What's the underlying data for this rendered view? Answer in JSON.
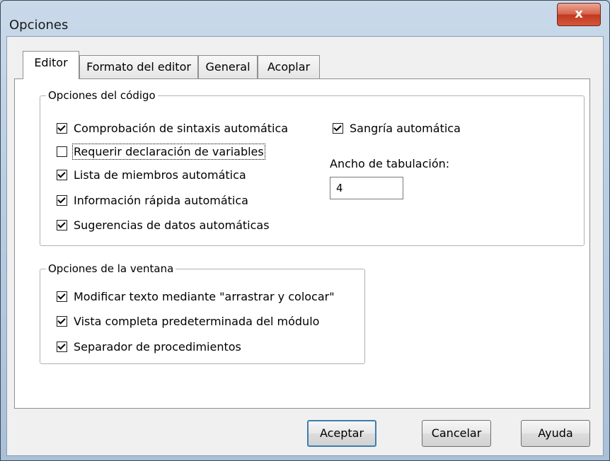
{
  "window": {
    "title": "Opciones",
    "close_glyph": "x"
  },
  "tabs": [
    {
      "label": "Editor",
      "active": true
    },
    {
      "label": "Formato del editor",
      "active": false
    },
    {
      "label": "General",
      "active": false
    },
    {
      "label": "Acoplar",
      "active": false
    }
  ],
  "code_options": {
    "legend": "Opciones del código",
    "items": [
      {
        "label": "Comprobación de sintaxis automática",
        "checked": true
      },
      {
        "label": "Requerir declaración de variables",
        "checked": false
      },
      {
        "label": "Lista de miembros automática",
        "checked": true
      },
      {
        "label": "Información rápida automática",
        "checked": true
      },
      {
        "label": "Sugerencias de datos automáticas",
        "checked": true
      }
    ],
    "auto_indent": {
      "label": "Sangría automática",
      "checked": true
    },
    "tab_width": {
      "label": "Ancho de tabulación:",
      "value": "4"
    }
  },
  "window_options": {
    "legend": "Opciones de la ventana",
    "items": [
      {
        "label": "Modificar texto mediante \"arrastrar y colocar\"",
        "checked": true
      },
      {
        "label": "Vista completa predeterminada del módulo",
        "checked": true
      },
      {
        "label": "Separador de procedimientos",
        "checked": true
      }
    ]
  },
  "buttons": {
    "ok": "Aceptar",
    "cancel": "Cancelar",
    "help": "Ayuda"
  }
}
